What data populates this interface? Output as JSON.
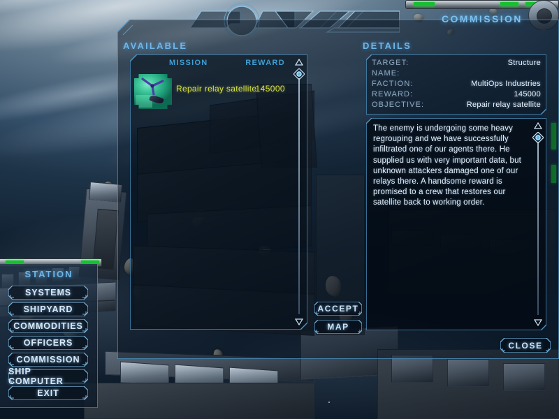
{
  "window": {
    "title": "COMMISSION"
  },
  "available": {
    "title": "AVAILABLE",
    "columns": {
      "mission": "MISSION",
      "reward": "REWARD"
    },
    "rows": [
      {
        "name": "Repair relay satellite",
        "reward": "145000",
        "thumbnail": "relay-satellite-thumbnail"
      }
    ]
  },
  "details": {
    "title": "DETAILS",
    "fields": [
      {
        "label": "TARGET:",
        "value": "Structure"
      },
      {
        "label": "NAME:",
        "value": ""
      },
      {
        "label": "FACTION:",
        "value": "MultiOps Industries"
      },
      {
        "label": "REWARD:",
        "value": "145000"
      },
      {
        "label": "OBJECTIVE:",
        "value": "Repair relay satellite"
      }
    ],
    "description": "The enemy is undergoing some heavy regrouping and we have successfully infiltrated one of our agents there. He supplied us with very important data, but unknown attackers damaged one of our relays there. A handsome reward is promised to a crew that restores our satellite back to working order."
  },
  "actions": {
    "accept": "ACCEPT",
    "map": "MAP",
    "close": "CLOSE"
  },
  "station": {
    "title": "STATION",
    "items": [
      {
        "label": "SYSTEMS"
      },
      {
        "label": "SHIPYARD"
      },
      {
        "label": "COMMODITIES"
      },
      {
        "label": "OFFICERS"
      },
      {
        "label": "COMMISSION"
      },
      {
        "label": "SHIP COMPUTER"
      },
      {
        "label": "EXIT"
      }
    ]
  },
  "icons": {
    "scroll_up": "scroll-up-arrow-icon",
    "scroll_down": "scroll-down-arrow-icon",
    "scroll_thumb": "scroll-thumb-diamond-icon"
  },
  "colors": {
    "accent": "#5fa8d8",
    "title": "#6fb6e8",
    "header": "#3f9fd4",
    "row_text": "#d6e04a",
    "value_text": "#e9f2fa",
    "label_text": "#8fa6b8",
    "panel_fill": "#0a1826",
    "station_green": "#17c030"
  }
}
